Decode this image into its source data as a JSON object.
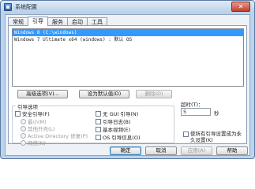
{
  "window": {
    "title": "系统配置",
    "close_label": "✕"
  },
  "tabs": [
    {
      "label": "常规"
    },
    {
      "label": "引导"
    },
    {
      "label": "服务"
    },
    {
      "label": "启动"
    },
    {
      "label": "工具"
    }
  ],
  "boot_entries": [
    "Windows 8 (C:\\windows)",
    "Windows 7 Ultimate x64 (windows) : 默认 OS"
  ],
  "buttons": {
    "advanced": "高级选项(V)...",
    "set_default": "设为默认值(D)",
    "delete": "删除(D)",
    "ok": "确定",
    "cancel": "取消",
    "apply": "应用(A)",
    "help": "帮助"
  },
  "boot_options": {
    "title": "引导选项",
    "safe_boot": "安全引导(F)",
    "minimal": "最小(M)",
    "alternate_shell": "其他外壳(L)",
    "active_directory": "Active Directory 修复(P)",
    "network": "网络(N)",
    "no_gui": "无 GUI 引导(N)",
    "boot_log": "引导日志(B)",
    "base_video": "基本视频(E)",
    "os_boot_info": "OS 引导信息(O)"
  },
  "timeout": {
    "label": "超时(T)：",
    "value": "5",
    "unit": "秒"
  },
  "permanent": {
    "label": "使所有引导设置成为永久设置(K)"
  }
}
